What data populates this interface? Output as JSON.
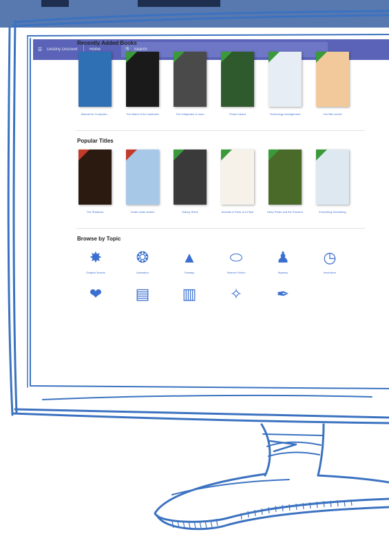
{
  "header": {
    "app_title": "Destiny Discover",
    "home_label": "Home",
    "search_placeholder": "Search"
  },
  "colors": {
    "header_bg": "#5b63b8",
    "link": "#3a6fd0",
    "badge_new": "#3a9a3a",
    "badge_popular": "#c23a2a",
    "sketch_outline": "#3b72c0"
  },
  "recently_added": {
    "title": "Recently Added Books",
    "books": [
      {
        "title": "Manual for Computer...",
        "cover": "#2f6fb4",
        "badge": "none"
      },
      {
        "title": "The island of the sunflower",
        "cover": "#1a1a1a",
        "badge": "new"
      },
      {
        "title": "The refrigerator & more",
        "cover": "#4a4a4a",
        "badge": "new"
      },
      {
        "title": "Flower Island",
        "cover": "#2e5a2e",
        "badge": "new"
      },
      {
        "title": "Technology management",
        "cover": "#e6edf4",
        "badge": "new"
      },
      {
        "title": "Our little secret",
        "cover": "#f1c99a",
        "badge": "new"
      }
    ]
  },
  "popular": {
    "title": "Popular Titles",
    "books": [
      {
        "title": "The Shadows",
        "cover": "#2a1a10",
        "badge": "popular"
      },
      {
        "title": "Under water stories",
        "cover": "#a8c8e8",
        "badge": "popular"
      },
      {
        "title": "Galaxy Shine",
        "cover": "#3a3a3a",
        "badge": "new"
      },
      {
        "title": "Animals & Parts of a Plant",
        "cover": "#f6f2ea",
        "badge": "new"
      },
      {
        "title": "Harry Potter and the Sorcerer",
        "cover": "#4a6a2a",
        "badge": "new"
      },
      {
        "title": "Everything Something",
        "cover": "#dde8f0",
        "badge": "new"
      }
    ]
  },
  "topics": {
    "title": "Browse by Topic",
    "items": [
      {
        "label": "Graphic Novels",
        "icon": "explosion-icon"
      },
      {
        "label": "Animation",
        "icon": "puzzle-icon"
      },
      {
        "label": "Fantasy",
        "icon": "wizard-hat-icon"
      },
      {
        "label": "Science Fiction",
        "icon": "ufo-icon"
      },
      {
        "label": "Mystery",
        "icon": "detective-icon"
      },
      {
        "label": "Inventions",
        "icon": "clock-icon"
      },
      {
        "label": "",
        "icon": "hand-heart-icon"
      },
      {
        "label": "",
        "icon": "bus-icon"
      },
      {
        "label": "",
        "icon": "building-icon"
      },
      {
        "label": "",
        "icon": "fairy-icon"
      },
      {
        "label": "",
        "icon": "feather-quill-icon"
      }
    ]
  }
}
